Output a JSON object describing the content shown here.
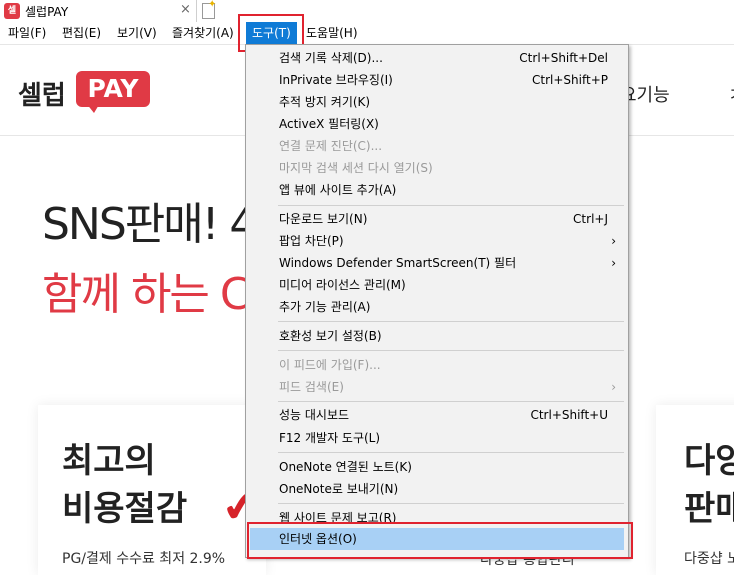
{
  "tab": {
    "favicon_text": "셀",
    "title": "셀럽PAY",
    "close_glyph": "×"
  },
  "menubar": {
    "items": [
      {
        "label": "파일(F)"
      },
      {
        "label": "편집(E)"
      },
      {
        "label": "보기(V)"
      },
      {
        "label": "즐겨찾기(A)"
      },
      {
        "label": "도구(T)"
      },
      {
        "label": "도움말(H)"
      }
    ]
  },
  "tools_menu": {
    "items": [
      {
        "label": "검색 기록 삭제(D)...",
        "shortcut": "Ctrl+Shift+Del"
      },
      {
        "label": "InPrivate 브라우징(I)",
        "shortcut": "Ctrl+Shift+P"
      },
      {
        "label": "추적 방지 켜기(K)",
        "shortcut": ""
      },
      {
        "label": "ActiveX 필터링(X)",
        "shortcut": ""
      },
      {
        "label": "연결 문제 진단(C)...",
        "shortcut": ""
      },
      {
        "label": "마지막 검색 세션 다시 열기(S)",
        "shortcut": ""
      },
      {
        "label": "앱 뷰에 사이트 추가(A)",
        "shortcut": ""
      },
      {
        "label": "다운로드 보기(N)",
        "shortcut": "Ctrl+J"
      },
      {
        "label": "팝업 차단(P)",
        "shortcut": ""
      },
      {
        "label": "Windows Defender SmartScreen(T) 필터",
        "shortcut": ""
      },
      {
        "label": "미디어 라이선스 관리(M)",
        "shortcut": ""
      },
      {
        "label": "추가 기능 관리(A)",
        "shortcut": ""
      },
      {
        "label": "호환성 보기 설정(B)",
        "shortcut": ""
      },
      {
        "label": "이 피드에 가입(F)...",
        "shortcut": ""
      },
      {
        "label": "피드 검색(E)",
        "shortcut": ""
      },
      {
        "label": "성능 대시보드",
        "shortcut": "Ctrl+Shift+U"
      },
      {
        "label": "F12 개발자 도구(L)",
        "shortcut": ""
      },
      {
        "label": "OneNote 연결된 노트(K)",
        "shortcut": ""
      },
      {
        "label": "OneNote로 보내기(N)",
        "shortcut": ""
      },
      {
        "label": "웹 사이트 문제 보고(R)",
        "shortcut": ""
      },
      {
        "label": "인터넷 옵션(O)",
        "shortcut": ""
      }
    ],
    "submenu_arrow": "›"
  },
  "website": {
    "logo_text": "셀럽",
    "logo_badge": "PAY",
    "nav_partial": "요기능",
    "nav_edge": "ㅈ",
    "hero_line1": "SNS판매! 4",
    "hero_line2": "함께 하는 C",
    "card1": {
      "title_line1": "최고의",
      "title_line2": "비용절감",
      "desc": "PG/결제 수수료 최저 2.9%"
    },
    "card2": {
      "desc": "다중샵 통합관리"
    },
    "card3": {
      "title_line1": "다양",
      "title_line2": "판매",
      "desc": "다중샵 노"
    },
    "checkmark": "✔"
  },
  "colors": {
    "accent_red": "#e03a45",
    "menu_active": "#0f7bd6",
    "menu_selected": "#a8d0f5",
    "highlight_box": "#e0232f"
  }
}
